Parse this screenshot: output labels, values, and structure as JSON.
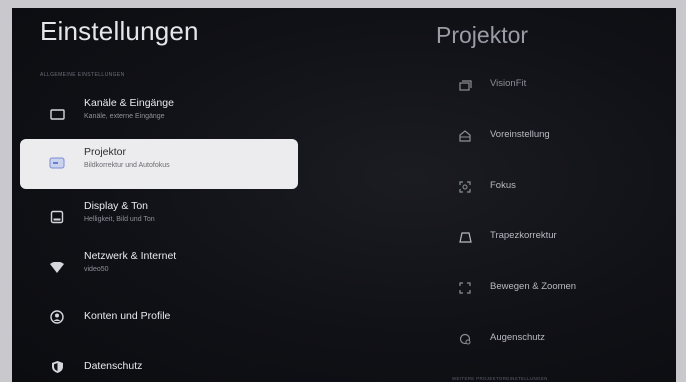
{
  "left": {
    "title": "Einstellungen",
    "section_label": "ALLGEMEINE EINSTELLUNGEN",
    "items": [
      {
        "label": "Kanäle & Eingänge",
        "sub": "Kanäle, externe Eingänge",
        "icon": "tv-icon"
      },
      {
        "label": "Projektor",
        "sub": "Bildkorrektur und Autofokus",
        "icon": "projector-icon"
      },
      {
        "label": "Display & Ton",
        "sub": "Helligkeit, Bild und Ton",
        "icon": "display-icon"
      },
      {
        "label": "Netzwerk & Internet",
        "sub": "video50",
        "icon": "wifi-icon"
      },
      {
        "label": "Konten und Profile",
        "sub": "",
        "icon": "account-icon"
      },
      {
        "label": "Datenschutz",
        "sub": "",
        "icon": "shield-icon"
      }
    ]
  },
  "right": {
    "title": "Projektor",
    "options": [
      {
        "label": "VisionFit",
        "icon": "visionfit-icon"
      },
      {
        "label": "Voreinstellung",
        "icon": "preset-icon"
      },
      {
        "label": "Fokus",
        "icon": "focus-icon"
      },
      {
        "label": "Trapezkorrektur",
        "icon": "keystone-icon"
      },
      {
        "label": "Bewegen & Zoomen",
        "icon": "move-zoom-icon"
      },
      {
        "label": "Augenschutz",
        "icon": "eye-protection-icon"
      }
    ],
    "bottom_label": "WEITERE PROJEKTOREINSTELLUNGEN"
  },
  "colors": {
    "background": "#101116",
    "selected_bg": "#ecebed",
    "text_primary": "#e9e9ee",
    "text_secondary": "#8f919b"
  }
}
